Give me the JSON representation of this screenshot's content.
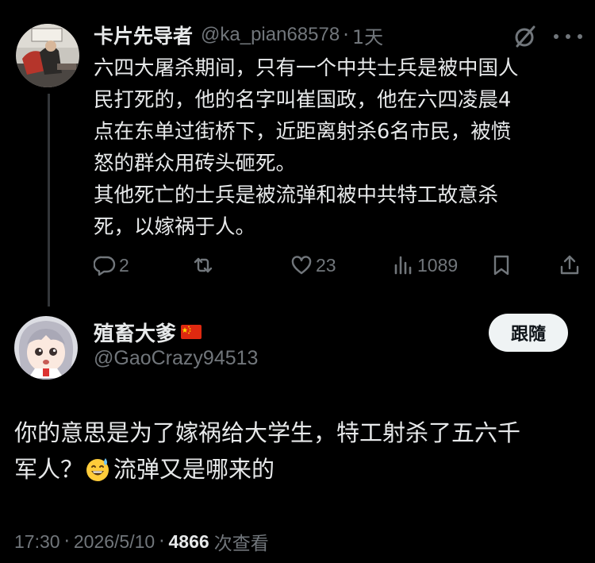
{
  "parent": {
    "display_name": "卡片先导者",
    "handle": "@ka_pian68578",
    "time": "1天",
    "lines": [
      "六四大屠杀期间，只有一个中共士兵是被中国人",
      "民打死的，他的名字叫崔国政，他在六四凌晨4",
      "点在东单过街桥下，近距离射杀6名市民，被愤",
      "怒的群众用砖头砸死。",
      "其他死亡的士兵是被流弹和被中共特工故意杀",
      "死，以嫁祸于人。"
    ],
    "reply_count": "2",
    "like_count": "23",
    "view_count": "1089",
    "icons": [
      "grok-icon",
      "more-icon",
      "reply-icon",
      "repost-icon",
      "like-icon",
      "views-icon",
      "bookmark-icon",
      "share-icon"
    ]
  },
  "reply": {
    "display_name": "殖畜大爹",
    "handle": "@GaoCrazy94513",
    "follow_label": "跟隨",
    "line1": "你的意思是为了嫁祸给大学生，特工射杀了五六千",
    "line2_a": "军人？",
    "line2_b": "流弹又是哪来的",
    "emoji": "sweat-smile-emoji",
    "flag": "china-flag"
  },
  "footer": {
    "time": "17:30",
    "date": "2026/5/10",
    "views": "4866",
    "views_label": "次查看"
  },
  "colors": {
    "background": "#000000",
    "text": "#e7e9ea",
    "secondary": "#71767b",
    "follow_button": "#eff3f4"
  }
}
